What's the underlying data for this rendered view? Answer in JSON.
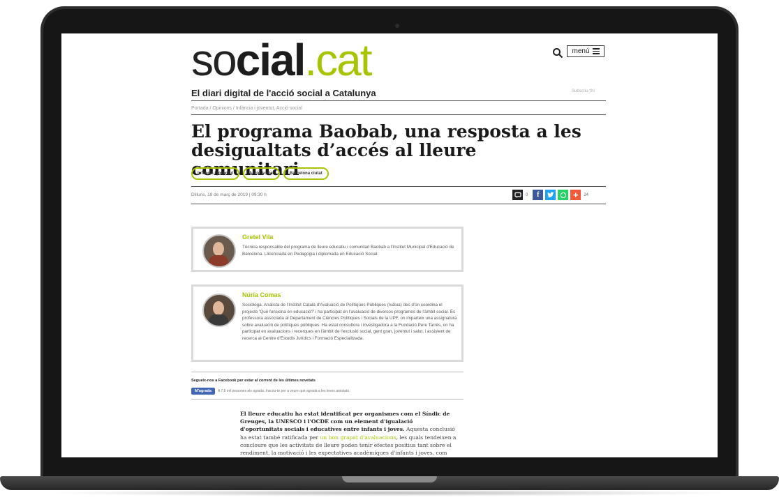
{
  "site": {
    "logo_part1": "so",
    "logo_part2": "cial",
    "logo_part3": ".cat",
    "tagline": "El diari digital de l'acció social a Catalunya",
    "menu_label": "menú",
    "subscribe_label": "Subscriu-t'hi",
    "accent_color": "#a8c400"
  },
  "breadcrumb": "Portada / Opinions / Infància i joventut, Acció social",
  "article": {
    "title": "El programa Baobab, una resposta a les desigualtats d’accés al lleure comunitari",
    "tags": [
      "Infància i joventut",
      "Acció social",
      "Barcelona ciutat"
    ],
    "dateline": "Dilluns, 18 de març de 2019 | 09:30 h",
    "comment_count": "0",
    "share_count": "24",
    "share_icons": [
      "comment-icon",
      "facebook-icon",
      "twitter-icon",
      "whatsapp-icon",
      "plus-icon"
    ]
  },
  "authors": [
    {
      "name": "Gretel Vila",
      "bio": "Tècnica responsable del programa de lleure educatiu i comunitari Baobab a l'Institut Municipal d'Educació de Barcelona. Llicenciada en Pedagogia i diplomada en Educació Social."
    },
    {
      "name": "Núria Comas",
      "bio": "Sociòloga. Analista de l'Institut Català d'Avaluació de Polítiques Públiques (Ivàlua) des d'on coordina el projecte 'Què funciona en educació?' i ha participat en l'avaluació de diversos programes de l'àmbit social. És professora associada al Departament de Ciències Polítiques i Socials de la UPF, on imparteix una assignatura sobre avaluació de polítiques públiques. Ha estat consultora i investigadora a la Fundació Pere Tarrés, on ha participat en avaluacions i recerques en l'àmbit de l'exclusió social, gent gran, joventut i salut, i assistent de recerca al Centre d'Estudis Jurídics i Formació Especialitzada."
    }
  ],
  "newsletter": {
    "title": "Segueix-nos a Facebook per estar al corrent de les últimes novetats",
    "like_label": "M'agrada",
    "like_text": "A 7,8 mil persones els agrada. Inscriu-te per a veure què agrada a les teves amistats."
  },
  "body": {
    "lead_bold": "El lleure educatiu ha estat identificat per organismes com el Síndic de Greuges, la UNESCO i l'OCDE com un element d'igualació d'oportunitats socials i educatives entre infants i joves.",
    "text_before_link": "Aquesta conclusió ha estat també ratificada per",
    "link_text": "un bon grapat d'avaluacions",
    "text_after_link": ", les quals tendeixen a concloure que les activitats de lleure poden tenir efectes positius tant sobre el rendiment, la motivació i les expectatives acadèmiques d'infants i joves, com sobre les seves conductes i"
  }
}
